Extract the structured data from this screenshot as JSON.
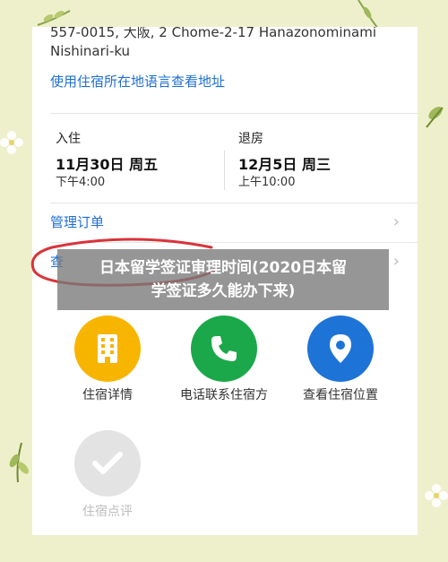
{
  "hotel": {
    "address_line1": "557-0015, 大阪, 2 Chome-2-17 Hanazonominami",
    "address_line2": "Nishinari-ku",
    "native_address_link": "使用住宿所在地语言查看地址"
  },
  "stay": {
    "checkin_label": "入住",
    "checkin_date": "11月30日 周五",
    "checkin_time": "下午4:00",
    "checkout_label": "退房",
    "checkout_date": "12月5日 周三",
    "checkout_time": "上午10:00"
  },
  "links": {
    "manage_order": "管理订单",
    "view_partial": "查",
    "chevron": "›"
  },
  "overlay": {
    "line1": "日本留学签证审理时间(2020日本留",
    "line2": "学签证多久能办下来)"
  },
  "actions": {
    "details": "住宿详情",
    "call": "电话联系住宿方",
    "location": "查看住宿位置",
    "review": "住宿点评"
  },
  "colors": {
    "details": "#f7b500",
    "call": "#1aa84a",
    "location": "#1e73d6",
    "review": "#e3e3e3",
    "link": "#1f6fd1",
    "annotation": "#d8343a"
  }
}
